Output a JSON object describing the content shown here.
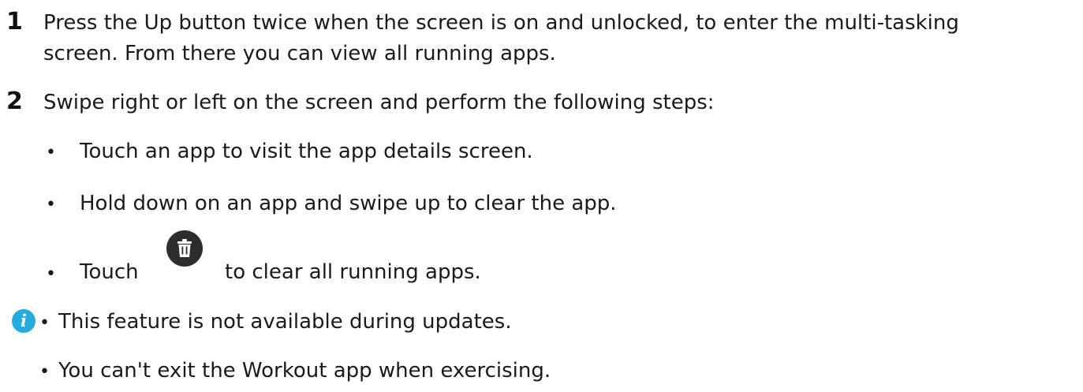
{
  "steps": [
    {
      "number": "1",
      "lines": [
        "Press the Up button twice when the screen is on and unlocked, to enter the multi-tasking",
        "screen. From there you can view all running apps."
      ]
    },
    {
      "number": "2",
      "lines": [
        "Swipe right or left on the screen and perform the following steps:"
      ]
    }
  ],
  "bullets": [
    "Touch an app to visit the app details screen.",
    "Hold down on an app and swipe up to clear the app."
  ],
  "touch_bullet": {
    "before": "Touch",
    "icon": "trash-icon",
    "after": "to clear all running apps."
  },
  "bullet_char": "•",
  "note": {
    "icon": "info-icon",
    "icon_glyph": "i",
    "items": [
      "This feature is not available during updates.",
      "You can't exit the Workout app when exercising."
    ]
  },
  "colors": {
    "text": "#1a1a1a",
    "info_icon": "#27aadc",
    "trash_icon_bg": "#2d2d2d"
  }
}
